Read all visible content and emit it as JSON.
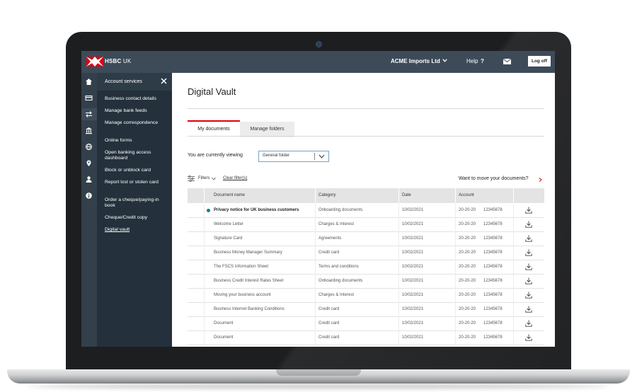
{
  "header": {
    "brand": "HSBC",
    "brand_suffix": "UK",
    "company": "ACME Imports Ltd",
    "help": "Help",
    "help_icon": "?",
    "logoff": "Log off"
  },
  "rail_icons": [
    "home-icon",
    "card-icon",
    "transfer-icon",
    "bank-icon",
    "globe-icon",
    "location-icon",
    "user-icon",
    "info-icon"
  ],
  "sidemenu": {
    "title": "Account services",
    "items": [
      {
        "label": "Business contact details"
      },
      {
        "label": "Manage bank feeds"
      },
      {
        "label": "Manage correspondence"
      },
      {
        "label": "Online forms"
      },
      {
        "label": "Open banking access dashboard"
      },
      {
        "label": "Block or unblock card"
      },
      {
        "label": "Report lost or stolen card"
      },
      {
        "label": "Order a cheque/paying-in book"
      },
      {
        "label": "Cheque/Credit copy"
      },
      {
        "label": "Digital vault"
      }
    ]
  },
  "main": {
    "title": "Digital Vault",
    "tabs": [
      {
        "label": "My documents"
      },
      {
        "label": "Manage folders"
      }
    ],
    "viewing_label": "You are currently viewing",
    "folder_select": "General folder",
    "filters": "Filters",
    "clear_filters": "Clear filter(s)",
    "move_documents": "Want to move your documents?",
    "table": {
      "headers": [
        "Document name",
        "Category",
        "Date",
        "Account"
      ],
      "rows": [
        {
          "name": "Privacy notice for UK business customers",
          "category": "Onboarding documents",
          "date": "10/02/2021",
          "sort": "20-20-20",
          "account": "12345678",
          "unread": true
        },
        {
          "name": "Welcome Letter",
          "category": "Charges & Interest",
          "date": "10/02/2021",
          "sort": "20-20-20",
          "account": "12345678"
        },
        {
          "name": "Signature Card",
          "category": "Agreements",
          "date": "10/02/2021",
          "sort": "20-20-20",
          "account": "12345678"
        },
        {
          "name": "Business Money Manager Summary",
          "category": "Credit card",
          "date": "10/02/2021",
          "sort": "20-20-20",
          "account": "12345678"
        },
        {
          "name": "The FSCS Information Sheet",
          "category": "Terms and conditions",
          "date": "10/02/2021",
          "sort": "20-20-20",
          "account": "12345678"
        },
        {
          "name": "Business Credit Interest Rates Sheet",
          "category": "Onboarding documents",
          "date": "10/02/2021",
          "sort": "20-20-20",
          "account": "12345678"
        },
        {
          "name": "Moving your business account",
          "category": "Charges & Interest",
          "date": "10/02/2021",
          "sort": "20-20-20",
          "account": "12345678"
        },
        {
          "name": "Business Internet Banking Conditions",
          "category": "Credit card",
          "date": "10/02/2021",
          "sort": "20-20-20",
          "account": "12345678"
        },
        {
          "name": "Document",
          "category": "Credit card",
          "date": "10/02/2021",
          "sort": "20-20-20",
          "account": "12345678"
        },
        {
          "name": "Document",
          "category": "Credit card",
          "date": "10/02/2021",
          "sort": "20-20-20",
          "account": "12345678"
        }
      ]
    }
  },
  "colors": {
    "brand_red": "#db0011",
    "topbar": "#3d4b59",
    "sidemenu": "#24313c",
    "unread_dot": "#00847f"
  }
}
